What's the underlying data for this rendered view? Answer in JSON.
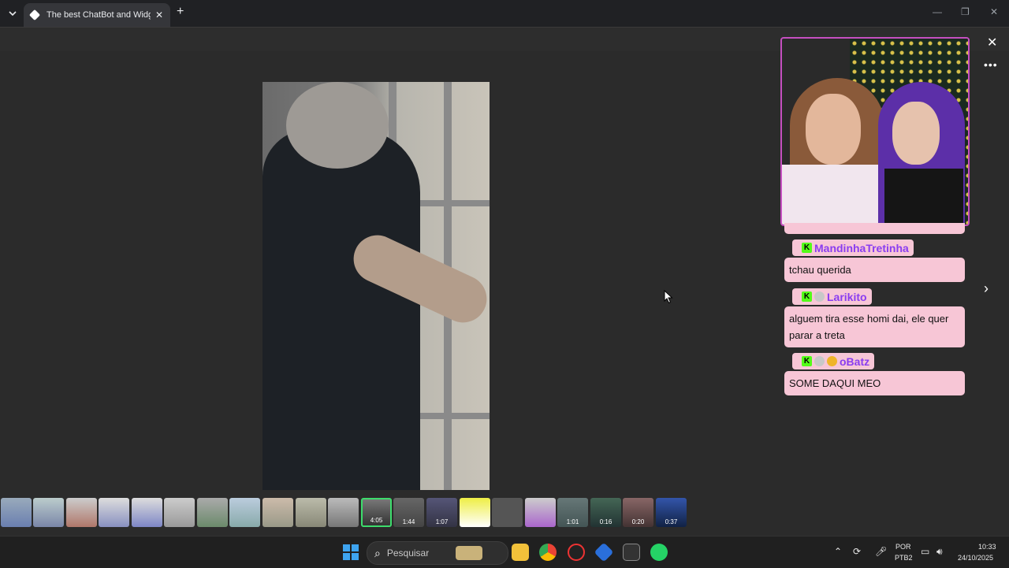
{
  "browser": {
    "tab_title": "The best ChatBot and Widgets",
    "tab_close": "✕",
    "new_tab": "+",
    "minimize": "—",
    "restore": "❐",
    "close": "✕"
  },
  "overlay": {
    "close": "✕",
    "more": "•••",
    "next": "›"
  },
  "chat": {
    "messages": [
      {
        "user": "MandinhaTretinha",
        "text": "tchau querida"
      },
      {
        "user": "Larikito",
        "text": "alguem tira esse homi dai, ele quer parar a treta"
      },
      {
        "user": "oBatz",
        "text": "SOME DAQUI MEO"
      }
    ],
    "badge_k": "K"
  },
  "thumbnails": {
    "durations": [
      "4:05",
      "1:44",
      "1:07",
      "1:01",
      "0:16",
      "0:20",
      "0:37"
    ]
  },
  "taskbar": {
    "search_placeholder": "Pesquisar",
    "lang_top": "POR",
    "lang_bottom": "PTB2",
    "time": "10:33",
    "date": "24/10/2025"
  },
  "colors": {
    "chat_bubble": "#f7c6d6",
    "username": "#8a3df0",
    "kick_green": "#53fc18",
    "webcam_border": "#c54fc0"
  }
}
